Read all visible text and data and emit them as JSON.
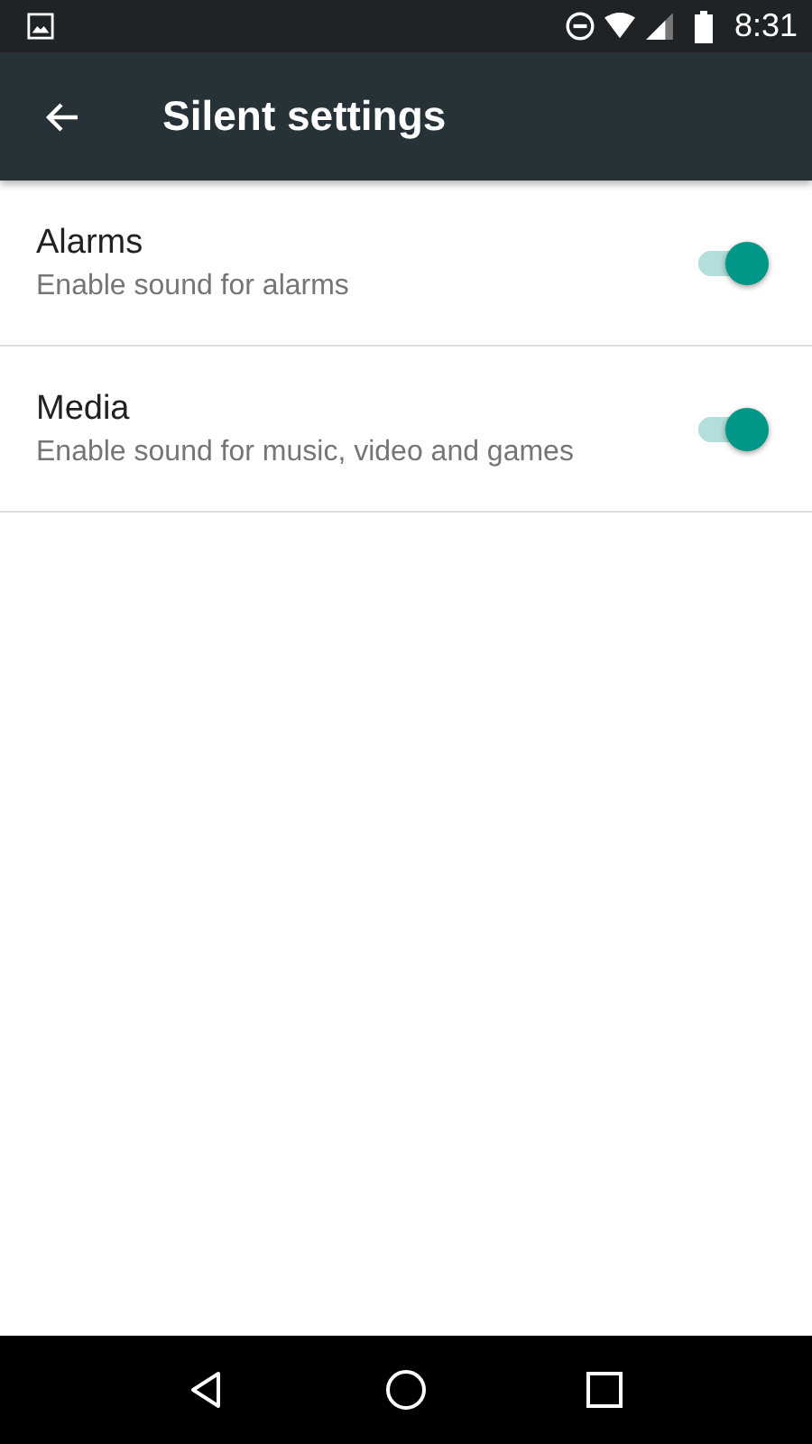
{
  "status_bar": {
    "time": "8:31"
  },
  "toolbar": {
    "title": "Silent settings"
  },
  "settings": [
    {
      "title": "Alarms",
      "summary": "Enable sound for alarms",
      "on": true
    },
    {
      "title": "Media",
      "summary": "Enable sound for music, video and games",
      "on": true
    }
  ]
}
